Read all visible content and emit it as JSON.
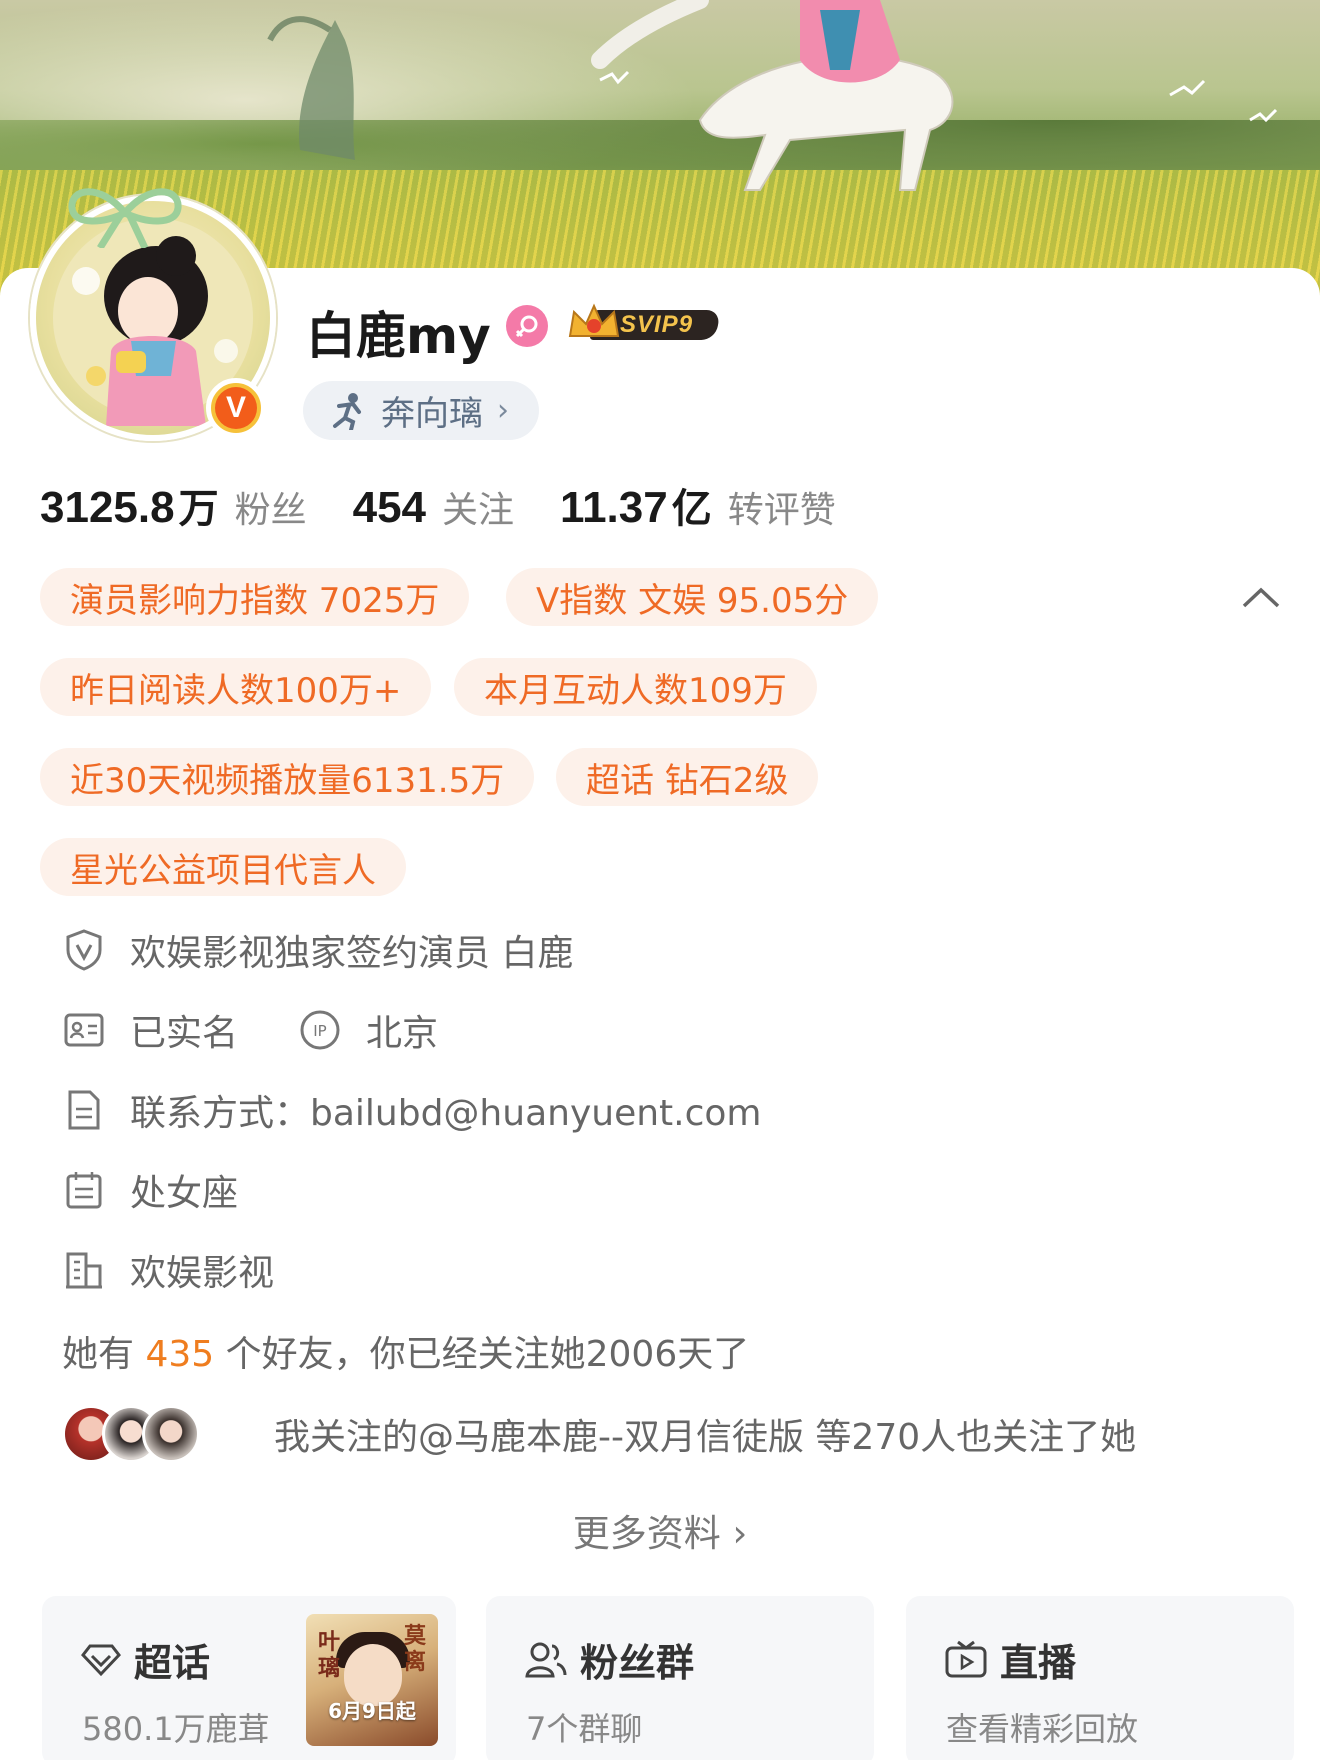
{
  "profile": {
    "name": "白鹿my",
    "gender_icon": "female-icon",
    "svip_label": "SVIP9",
    "verified_badge": "V",
    "tag_label": "奔向璃",
    "tag_chevron": "›"
  },
  "stats": [
    {
      "num": "3125.8",
      "unit": "万",
      "label": "粉丝"
    },
    {
      "num": "454",
      "unit": "",
      "label": "关注"
    },
    {
      "num": "11.37",
      "unit": "亿",
      "label": "转评赞"
    }
  ],
  "badges": [
    "演员影响力指数 7025万",
    "V指数 文娱 95.05分",
    "昨日阅读人数100万+",
    "本月互动人数109万",
    "近30天视频播放量6131.5万",
    "超话 钻石2级",
    "星光公益项目代言人"
  ],
  "info": {
    "verification": "欢娱影视独家签约演员 白鹿",
    "real_name": "已实名",
    "ip_location": "北京",
    "contact": "联系方式：bailubd@huanyuent.com",
    "zodiac": "处女座",
    "company": "欢娱影视"
  },
  "friends": {
    "prefix": "她有 ",
    "count": "435",
    "suffix": " 个好友，你已经关注她2006天了"
  },
  "mutual": {
    "text": "我关注的@马鹿本鹿--双月信徒版 等270人也关注了她"
  },
  "more_label": "更多资料 ›",
  "cards": [
    {
      "title": "超话",
      "sub": "580.1万鹿茸",
      "icon": "diamond-icon",
      "poster_top_left": "叶璃",
      "poster_top_right": "莫离",
      "poster_date": "6月9日起"
    },
    {
      "title": "粉丝群",
      "sub": "7个群聊",
      "icon": "group-icon"
    },
    {
      "title": "直播",
      "sub": "查看精彩回放",
      "icon": "tv-icon"
    }
  ],
  "colors": {
    "accent_orange": "#ef6a25",
    "pill_bg": "#fdf1ea",
    "verified_orange": "#f25d1a",
    "female_pink": "#f47aa8"
  }
}
